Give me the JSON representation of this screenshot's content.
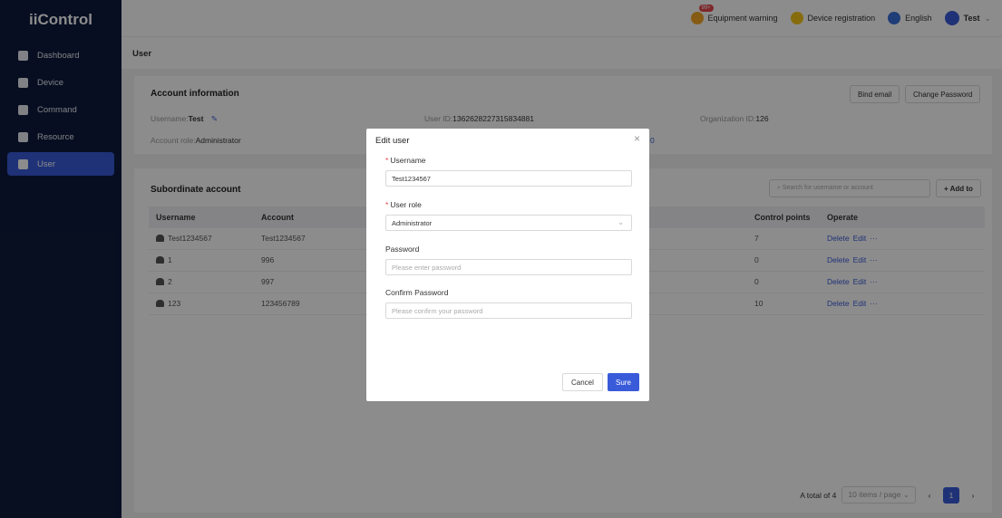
{
  "app": {
    "logo": "iiControl"
  },
  "sidebar": {
    "items": [
      {
        "label": "Dashboard"
      },
      {
        "label": "Device"
      },
      {
        "label": "Command"
      },
      {
        "label": "Resource"
      },
      {
        "label": "User"
      }
    ]
  },
  "header": {
    "warning": "Equipment warning",
    "warning_badge": "99+",
    "registration": "Device registration",
    "language": "English",
    "user": "Test"
  },
  "breadcrumb": "User",
  "account": {
    "title": "Account information",
    "bind_email": "Bind email",
    "change_password": "Change Password",
    "username_label": "Username:",
    "username": "Test",
    "userid_label": "User ID:",
    "userid": "1362628227315834881",
    "org_label": "Organization ID:",
    "org": "126",
    "role_label": "Account role:",
    "role": "Administrator",
    "partial": "0"
  },
  "subordinate": {
    "title": "Subordinate account",
    "search_placeholder": "Search for username or account",
    "add": "+ Add to",
    "columns": [
      "Username",
      "Account",
      "Control points",
      "Operate"
    ],
    "rows": [
      {
        "username": "Test1234567",
        "account": "Test1234567",
        "points": "7"
      },
      {
        "username": "1",
        "account": "996",
        "points": "0"
      },
      {
        "username": "2",
        "account": "997",
        "points": "0"
      },
      {
        "username": "123",
        "account": "123456789",
        "points": "10"
      }
    ],
    "ops": {
      "delete": "Delete",
      "edit": "Edit",
      "more": "···"
    },
    "pager": {
      "total": "A total of 4",
      "size": "10 items / page",
      "page": "1"
    }
  },
  "modal": {
    "title": "Edit user",
    "username_label": "Username",
    "username_value": "Test1234567",
    "role_label": "User role",
    "role_value": "Administrator",
    "password_label": "Password",
    "password_placeholder": "Please enter password",
    "confirm_label": "Confirm Password",
    "confirm_placeholder": "Please confirm your password",
    "cancel": "Cancel",
    "sure": "Sure"
  }
}
